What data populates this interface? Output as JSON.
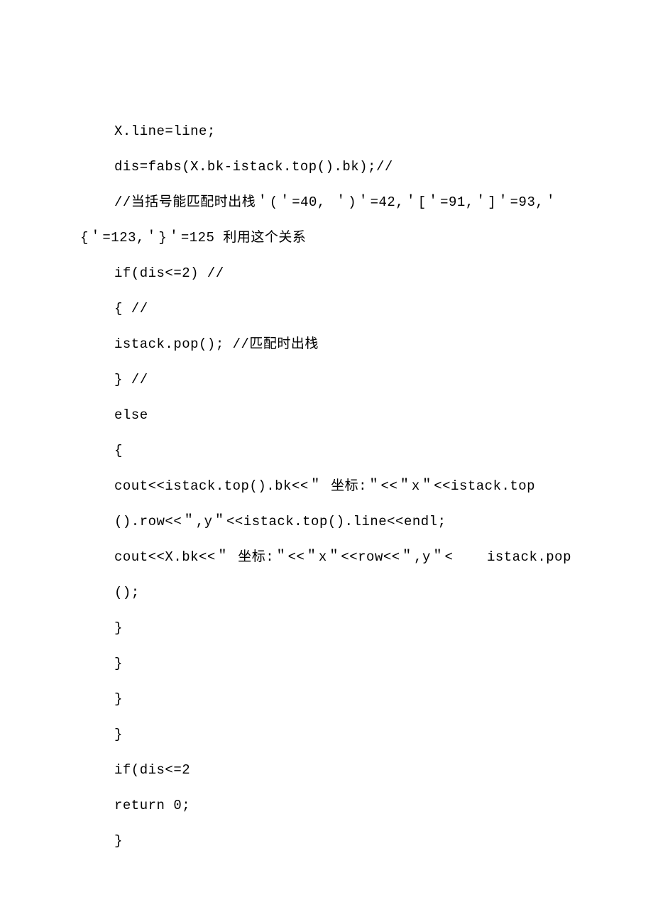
{
  "lines": [
    {
      "indent": true,
      "text": "X.line=line;"
    },
    {
      "indent": true,
      "text": "dis=fabs(X.bk-istack.top().bk);//"
    },
    {
      "indent": true,
      "text": "//当括号能匹配时出栈＇(＇=40, ＇)＇=42,＇[＇=91,＇]＇=93,＇"
    },
    {
      "indent": false,
      "text": "{＇=123,＇}＇=125 利用这个关系"
    },
    {
      "indent": true,
      "text": "if(dis<=2) //"
    },
    {
      "indent": true,
      "text": "{ //"
    },
    {
      "indent": true,
      "text": "istack.pop(); //匹配时出栈"
    },
    {
      "indent": true,
      "text": "} //"
    },
    {
      "indent": true,
      "text": "else"
    },
    {
      "indent": true,
      "text": "{"
    },
    {
      "indent": true,
      "text": "cout<<istack.top().bk<<＂ 坐标:＂<<＂x＂<<istack.top"
    },
    {
      "indent": true,
      "text": "().row<<＂,y＂<<istack.top().line<<endl;"
    },
    {
      "indent": true,
      "text": "cout<<X.bk<<＂ 坐标:＂<<＂x＂<<row<<＂,y＂<    istack.pop();"
    },
    {
      "indent": true,
      "text": "}"
    },
    {
      "indent": true,
      "text": "}"
    },
    {
      "indent": true,
      "text": "}"
    },
    {
      "indent": true,
      "text": "}"
    },
    {
      "indent": true,
      "text": "if(dis<=2"
    },
    {
      "indent": true,
      "text": "return 0;"
    },
    {
      "indent": true,
      "text": "}"
    }
  ]
}
